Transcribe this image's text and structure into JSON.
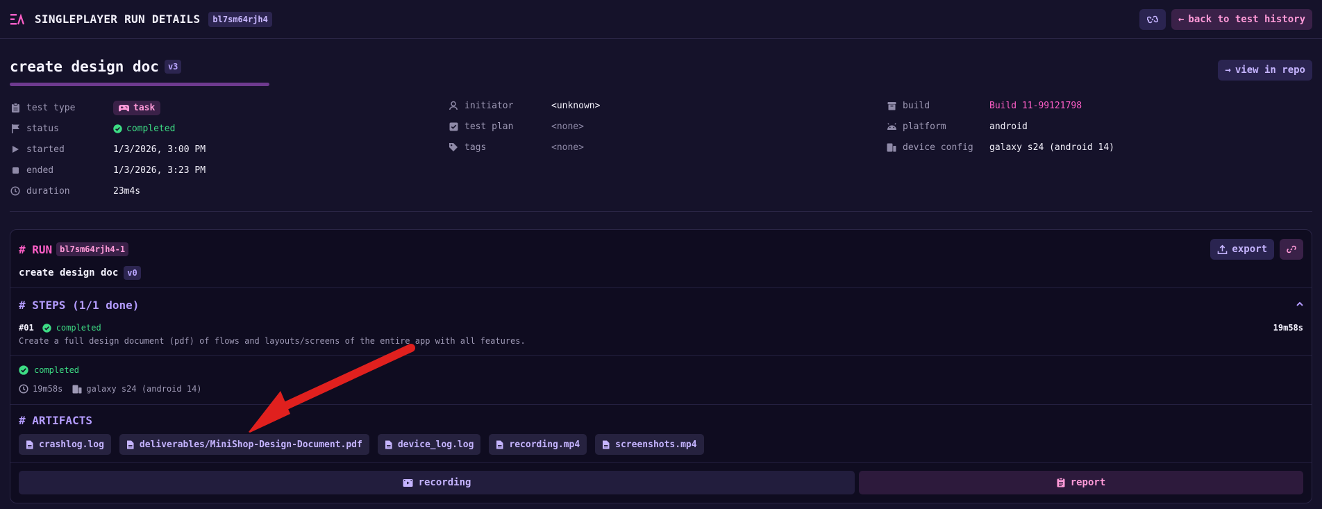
{
  "header": {
    "title": "SINGLEPLAYER RUN DETAILS",
    "id": "bl7sm64rjh4",
    "back_label": "back to test history"
  },
  "test": {
    "title": "create design doc",
    "version": "v3",
    "view_repo_label": "view in repo"
  },
  "meta": {
    "col1": [
      {
        "label": "test type",
        "value": "task",
        "icon": "clipboard-icon"
      },
      {
        "label": "status",
        "value": "completed",
        "icon": "flag-icon"
      },
      {
        "label": "started",
        "value": "1/3/2026, 3:00 PM",
        "icon": "play-icon"
      },
      {
        "label": "ended",
        "value": "1/3/2026, 3:23 PM",
        "icon": "stop-icon"
      },
      {
        "label": "duration",
        "value": "23m4s",
        "icon": "clock-icon"
      }
    ],
    "col2": [
      {
        "label": "initiator",
        "value": "<unknown>",
        "icon": "user-icon"
      },
      {
        "label": "test plan",
        "value": "<none>",
        "icon": "checklist-icon"
      },
      {
        "label": "tags",
        "value": "<none>",
        "icon": "tag-icon"
      }
    ],
    "col3": [
      {
        "label": "build",
        "value": "Build 11-99121798",
        "icon": "package-icon"
      },
      {
        "label": "platform",
        "value": "android",
        "icon": "android-icon"
      },
      {
        "label": "device config",
        "value": "galaxy s24 (android 14)",
        "icon": "devices-icon"
      }
    ]
  },
  "run": {
    "heading": "# RUN",
    "id": "bl7sm64rjh4-1",
    "name": "create design doc",
    "version": "v0",
    "export_label": "export"
  },
  "steps": {
    "heading": "# STEPS (1/1 done)",
    "items": [
      {
        "num": "#01",
        "status": "completed",
        "duration": "19m58s",
        "description": "Create a full design document (pdf) of flows and layouts/screens of the entire app with all features."
      }
    ]
  },
  "summary": {
    "status": "completed",
    "duration": "19m58s",
    "device": "galaxy s24 (android 14)"
  },
  "artifacts": {
    "heading": "# ARTIFACTS",
    "files": [
      "crashlog.log",
      "deliverables/MiniShop-Design-Document.pdf",
      "device_log.log",
      "recording.mp4",
      "screenshots.mp4"
    ]
  },
  "footer": {
    "recording_label": "recording",
    "report_label": "report"
  },
  "colors": {
    "background": "#15122a",
    "accent_pink": "#ff5fc8",
    "accent_purple": "#b49cff",
    "success": "#3ddc84",
    "annotation_arrow": "#e0201e"
  }
}
